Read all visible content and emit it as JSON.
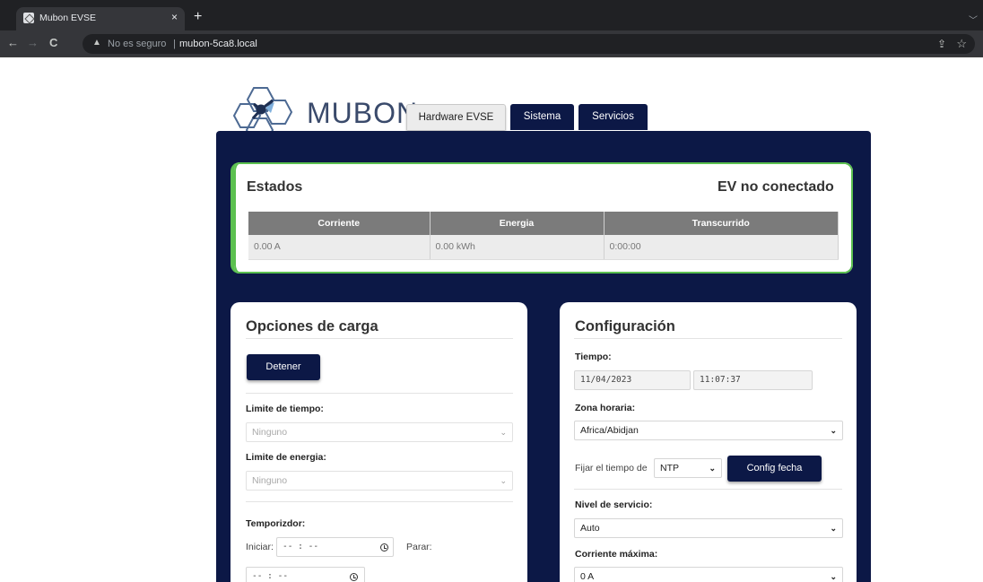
{
  "browser": {
    "tab_title": "Mubon EVSE",
    "tab_close": "×",
    "new_tab": "+",
    "tab_menu": "﹀",
    "back": "←",
    "forward": "→",
    "reload": "C",
    "security_text": "No es seguro",
    "url": "mubon-5ca8.local"
  },
  "brand": {
    "logo_text": "MUBON"
  },
  "nav": {
    "tabs": [
      {
        "label": "Hardware EVSE",
        "active": true
      },
      {
        "label": "Sistema",
        "active": false
      },
      {
        "label": "Servicios",
        "active": false
      }
    ]
  },
  "status": {
    "title": "Estados",
    "ev_state": "EV no conectado",
    "columns": [
      "Corriente",
      "Energia",
      "Transcurrido"
    ],
    "values": [
      "0.00 A",
      "0.00 kWh",
      "0:00:00"
    ],
    "accent_color": "#5bc04f"
  },
  "charge_options": {
    "title": "Opciones de carga",
    "stop_button": "Detener",
    "time_limit_label": "Limite de tiempo:",
    "time_limit_value": "Ninguno",
    "energy_limit_label": "Limite de energia:",
    "energy_limit_value": "Ninguno",
    "timer_label": "Temporizdor:",
    "start_label": "Iniciar:",
    "start_value": "-- : --",
    "stop_label": "Parar:",
    "stop_value": "-- : --"
  },
  "config": {
    "title": "Configuración",
    "time_label": "Tiempo:",
    "date_value": "11/04/2023",
    "time_value": "11:07:37",
    "timezone_label": "Zona horaria:",
    "timezone_value": "Africa/Abidjan",
    "set_time_from_label": "Fijar el tiempo de",
    "set_time_source": "NTP",
    "set_date_button": "Config fecha",
    "service_level_label": "Nivel de servicio:",
    "service_level_value": "Auto",
    "max_current_label": "Corriente máxima:",
    "max_current_value": "0 A"
  },
  "colors": {
    "navy": "#0c1846",
    "table_header": "#7b7b7b"
  }
}
